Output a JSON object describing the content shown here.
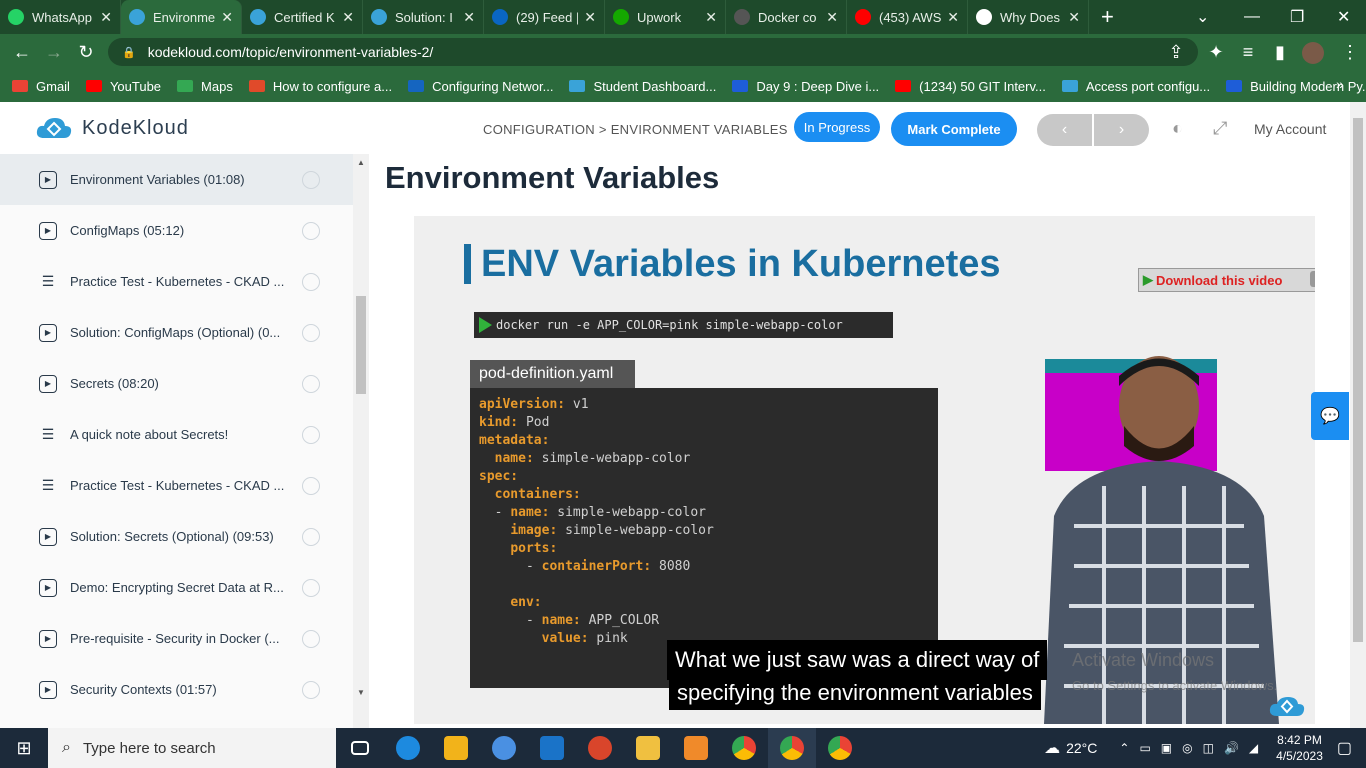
{
  "browser": {
    "tabs": [
      {
        "label": "WhatsApp",
        "color": "#25d366"
      },
      {
        "label": "Environment V",
        "color": "#3aa3d8",
        "active": true
      },
      {
        "label": "Certified K",
        "color": "#3aa3d8"
      },
      {
        "label": "Solution: I",
        "color": "#3aa3d8"
      },
      {
        "label": "(29) Feed |",
        "color": "#0a66c2"
      },
      {
        "label": "Upwork",
        "color": "#14a800"
      },
      {
        "label": "Docker co",
        "color": "#555555"
      },
      {
        "label": "(453) AWS",
        "color": "#ff0000"
      },
      {
        "label": "Why Does",
        "color": "#ffffff"
      }
    ],
    "new_tab": "+",
    "url": "kodekloud.com/topic/environment-variables-2/",
    "bookmarks": [
      {
        "label": "Gmail",
        "color": "#ea4335"
      },
      {
        "label": "YouTube",
        "color": "#ff0000"
      },
      {
        "label": "Maps",
        "color": "#34a853"
      },
      {
        "label": "How to configure a...",
        "color": "#e04a2a"
      },
      {
        "label": "Configuring Networ...",
        "color": "#1565c0"
      },
      {
        "label": "Student Dashboard...",
        "color": "#3aa3d8"
      },
      {
        "label": "Day 9 : Deep Dive i...",
        "color": "#1e5dd8"
      },
      {
        "label": "(1234) 50 GIT Interv...",
        "color": "#ff0000"
      },
      {
        "label": "Access port configu...",
        "color": "#3aa3d8"
      },
      {
        "label": "Building Modern Py...",
        "color": "#1e5dd8"
      }
    ],
    "more_bookmarks": "»"
  },
  "header": {
    "logo_text": "KodeKloud",
    "breadcrumb": "CONFIGURATION > ENVIRONMENT VARIABLES",
    "status_label": "In Progress",
    "mark_complete_label": "Mark Complete",
    "prev_symbol": "‹",
    "next_symbol": "›",
    "account_label": "My Account"
  },
  "sidebar": {
    "lessons": [
      {
        "title": "Environment Variables (01:08)",
        "type": "video",
        "current": true
      },
      {
        "title": "ConfigMaps (05:12)",
        "type": "video"
      },
      {
        "title": "Practice Test - Kubernetes - CKAD ...",
        "type": "lab"
      },
      {
        "title": "Solution: ConfigMaps (Optional) (0...",
        "type": "video"
      },
      {
        "title": "Secrets (08:20)",
        "type": "video"
      },
      {
        "title": "A quick note about Secrets!",
        "type": "lab"
      },
      {
        "title": "Practice Test - Kubernetes - CKAD ...",
        "type": "lab"
      },
      {
        "title": "Solution: Secrets (Optional) (09:53)",
        "type": "video"
      },
      {
        "title": "Demo: Encrypting Secret Data at R...",
        "type": "video"
      },
      {
        "title": "Pre-requisite - Security in Docker (...",
        "type": "video"
      },
      {
        "title": "Security Contexts (01:57)",
        "type": "video"
      }
    ]
  },
  "main": {
    "title": "Environment Variables",
    "video": {
      "slide_title": "ENV Variables in Kubernetes",
      "docker_cmd": "docker run  -e APP_COLOR=pink simple-webapp-color",
      "yaml_filename": "pod-definition.yaml",
      "subtitle_line1": "What we just saw was a direct way of",
      "subtitle_line2": "specifying the environment variables",
      "download_label": "Download this video",
      "help": "?",
      "close": "X",
      "watermark_line1": "Activate Windows",
      "watermark_line2": "Go to Settings to activate Windows."
    }
  },
  "taskbar": {
    "search_placeholder": "Type here to search",
    "weather": "22°C",
    "time": "8:42 PM",
    "date": "4/5/2023"
  }
}
